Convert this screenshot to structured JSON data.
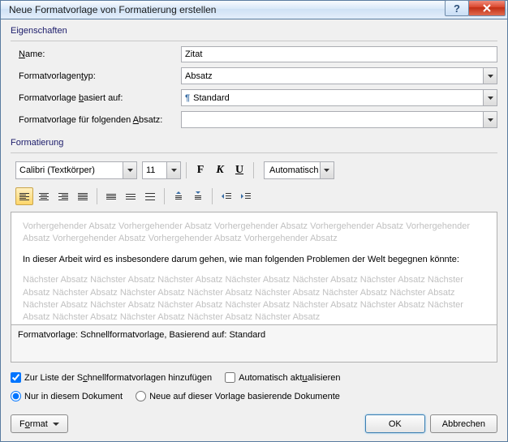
{
  "title": "Neue Formatvorlage von Formatierung erstellen",
  "groups": {
    "properties": "Eigenschaften",
    "formatting": "Formatierung"
  },
  "labels": {
    "name_pre": "",
    "name_u": "N",
    "name_post": "ame:",
    "type_pre": "Formatvorlagen",
    "type_u": "t",
    "type_post": "yp:",
    "based_pre": "Formatvorlage ",
    "based_u": "b",
    "based_post": "asiert auf:",
    "next_pre": "Formatvorlage für folgenden ",
    "next_u": "A",
    "next_post": "bsatz:"
  },
  "values": {
    "name": "Zitat",
    "type": "Absatz",
    "based": "Standard",
    "next": "",
    "font": "Calibri (Textkörper)",
    "size": "11",
    "color": "Automatisch"
  },
  "preview": {
    "before": "Vorhergehender Absatz Vorhergehender Absatz Vorhergehender Absatz Vorhergehender Absatz Vorhergehender Absatz Vorhergehender Absatz Vorhergehender Absatz Vorhergehender Absatz",
    "sample": "In dieser Arbeit wird es insbesondere darum gehen, wie man folgenden Problemen der Welt begegnen könnte:",
    "after": "Nächster Absatz Nächster Absatz Nächster Absatz Nächster Absatz Nächster Absatz Nächster Absatz Nächster Absatz Nächster Absatz Nächster Absatz Nächster Absatz Nächster Absatz Nächster Absatz Nächster Absatz Nächster Absatz Nächster Absatz Nächster Absatz Nächster Absatz Nächster Absatz Nächster Absatz Nächster Absatz Nächster Absatz Nächster Absatz Nächster Absatz Nächster Absatz"
  },
  "info": "Formatvorlage: Schnellformatvorlage, Basierend auf: Standard",
  "checks": {
    "quick_pre": "Zur Liste der S",
    "quick_u": "c",
    "quick_post": "hnellformatvorlagen hinzufügen",
    "auto_pre": "Automatisch akt",
    "auto_u": "u",
    "auto_post": "alisieren"
  },
  "radios": {
    "doc": "Nur in diesem Dokument",
    "tpl": "Neue auf dieser Vorlage basierende Dokumente"
  },
  "buttons": {
    "format_pre": "F",
    "format_u": "o",
    "format_post": "rmat",
    "ok": "OK",
    "cancel": "Abbrechen"
  }
}
